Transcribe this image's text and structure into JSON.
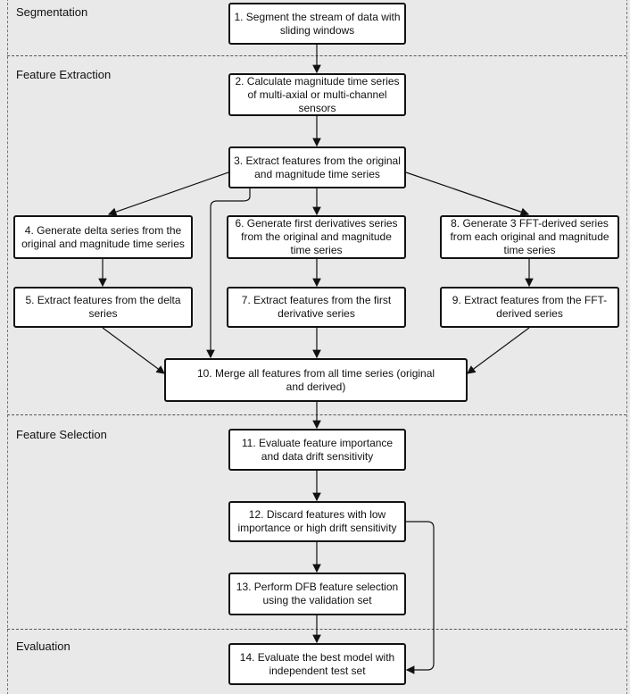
{
  "sections": [
    "Segmentation",
    "Feature Extraction",
    "Feature Selection",
    "Evaluation"
  ],
  "steps": {
    "s1": "1. Segment the stream of data with sliding windows",
    "s2": "2. Calculate magnitude time series of multi-axial or multi-channel sensors",
    "s3": "3. Extract features from the original and magnitude time series",
    "s4": "4. Generate delta series from the  original and magnitude time series",
    "s5": "5. Extract features from the delta series",
    "s6": "6. Generate first derivatives series from the original and magnitude time series",
    "s7": "7. Extract features from the first derivative series",
    "s8": "8. Generate 3 FFT-derived series from each original and magnitude time series",
    "s9": "9. Extract features from the FFT-derived series",
    "s10": "10. Merge all features from all time series (original and derived)",
    "s11": "11. Evaluate feature importance and data drift sensitivity",
    "s12": "12. Discard features with low importance or high drift sensitivity",
    "s13": "13. Perform DFB feature selection using the validation set",
    "s14": "14. Evaluate the best model with independent test set"
  }
}
